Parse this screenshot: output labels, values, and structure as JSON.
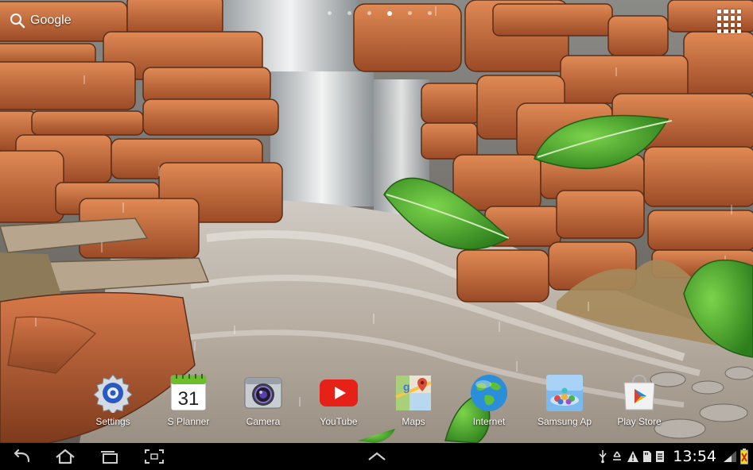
{
  "search": {
    "label": "Google"
  },
  "home_pages": {
    "count": 6,
    "active": 3
  },
  "dock": {
    "apps": [
      {
        "label": "Settings",
        "icon": "settings-gear-icon"
      },
      {
        "label": "S Planner",
        "icon": "calendar-icon",
        "badge": "31"
      },
      {
        "label": "Camera",
        "icon": "camera-icon"
      },
      {
        "label": "YouTube",
        "icon": "youtube-play-icon"
      },
      {
        "label": "Maps",
        "icon": "maps-pin-icon"
      },
      {
        "label": "Internet",
        "icon": "globe-icon"
      },
      {
        "label": "Samsung Ap",
        "icon": "samsung-apps-icon"
      },
      {
        "label": "Play Store",
        "icon": "play-store-icon"
      }
    ]
  },
  "navbar": {
    "buttons": [
      "back-icon",
      "home-icon",
      "recent-apps-icon",
      "screenshot-icon",
      "up-arrow-icon"
    ],
    "status_icons": [
      "usb-icon",
      "recycle-icon",
      "warning-icon",
      "sd-card-icon",
      "download-icon",
      "signal-icon",
      "battery-icon"
    ],
    "clock": "13:54"
  },
  "colors": {
    "navbar": "#000000",
    "rock": "#c8673a",
    "water": "#d8d4cf",
    "leaf": "#3f9a2b"
  }
}
